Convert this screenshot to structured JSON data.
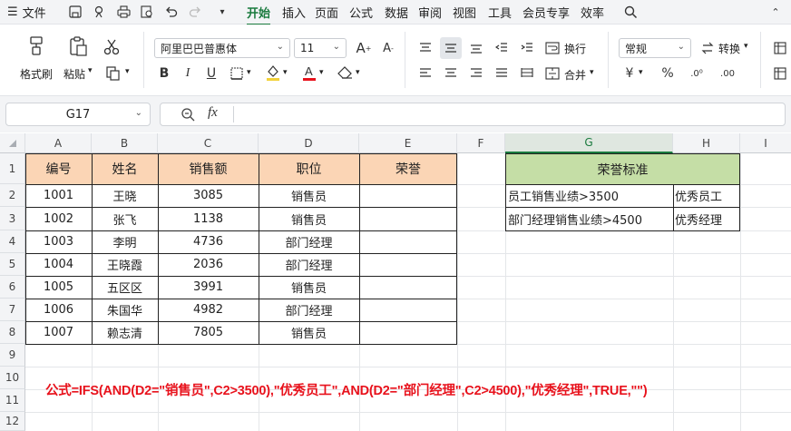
{
  "menubar": {
    "file_label": "文件",
    "tabs": [
      "开始",
      "插入",
      "页面",
      "公式",
      "数据",
      "审阅",
      "视图",
      "工具",
      "会员专享",
      "效率"
    ],
    "active_tab": "开始"
  },
  "ribbon": {
    "format_painter": "格式刷",
    "paste": "粘贴",
    "font_name": "阿里巴巴普惠体",
    "font_size": "11",
    "wrap": "换行",
    "merge": "合并",
    "number_format": "常规",
    "convert": "转换",
    "colors": {
      "accent": "#1a7a3e",
      "font_color": "#e8121c"
    }
  },
  "formula_bar": {
    "cell_ref": "G17",
    "fx": "fx",
    "value": ""
  },
  "columns": [
    "A",
    "B",
    "C",
    "D",
    "E",
    "F",
    "G",
    "H",
    "I"
  ],
  "rows": [
    "1",
    "2",
    "3",
    "4",
    "5",
    "6",
    "7",
    "8",
    "9",
    "10",
    "11",
    "12"
  ],
  "table": {
    "headers": [
      "编号",
      "姓名",
      "销售额",
      "职位",
      "荣誉"
    ],
    "rows": [
      [
        "1001",
        "王晓",
        "3085",
        "销售员",
        ""
      ],
      [
        "1002",
        "张飞",
        "1138",
        "销售员",
        ""
      ],
      [
        "1003",
        "李明",
        "4736",
        "部门经理",
        ""
      ],
      [
        "1004",
        "王晓霞",
        "2036",
        "部门经理",
        ""
      ],
      [
        "1005",
        "五区区",
        "3991",
        "销售员",
        ""
      ],
      [
        "1006",
        "朱国华",
        "4982",
        "部门经理",
        ""
      ],
      [
        "1007",
        "赖志清",
        "7805",
        "销售员",
        ""
      ]
    ],
    "header_color": "#fbd5b5"
  },
  "criteria": {
    "title": "荣誉标准",
    "rows": [
      [
        "员工销售业绩>3500",
        "优秀员工"
      ],
      [
        "部门经理销售业绩>4500",
        "优秀经理"
      ]
    ],
    "header_color": "#c5dea6"
  },
  "formula_note": "公式=IFS(AND(D2=\"销售员\",C2>3500),\"优秀员工\",AND(D2=\"部门经理\",C2>4500),\"优秀经理\",TRUE,\"\")"
}
